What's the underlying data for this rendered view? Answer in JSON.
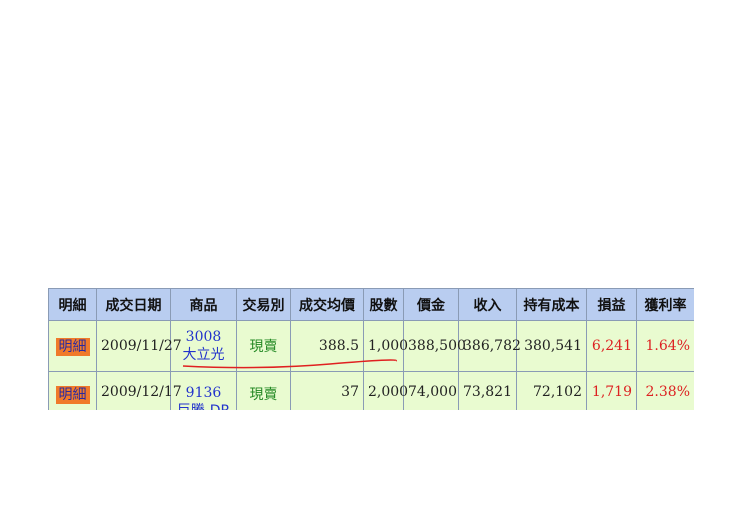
{
  "headers": [
    "明細",
    "成交日期",
    "商品",
    "交易別",
    "成交均價",
    "股數",
    "價金",
    "收入",
    "持有成本",
    "損益",
    "獲利率"
  ],
  "rows": [
    {
      "detail": "明細",
      "date": "2009/11/27",
      "code": "3008",
      "name": "大立光",
      "type": "現賣",
      "avg_price": "388.5",
      "shares": "1,000",
      "amount": "388,500",
      "income": "386,782",
      "cost": "380,541",
      "pnl": "6,241",
      "rate": "1.64%"
    },
    {
      "detail": "明細",
      "date": "2009/12/17",
      "code": "9136",
      "name": "巨騰-DR",
      "type": "現賣",
      "avg_price": "37",
      "shares": "2,000",
      "amount": "74,000",
      "income": "73,821",
      "cost": "72,102",
      "pnl": "1,719",
      "rate": "2.38%"
    }
  ]
}
